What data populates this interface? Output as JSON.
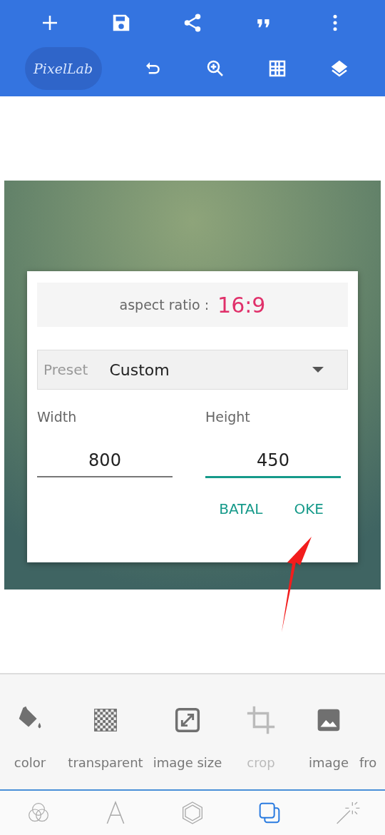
{
  "toolbar": {
    "logo": "PixelLab"
  },
  "dialog": {
    "aspect_label": "aspect ratio :",
    "aspect_value": "16:9",
    "preset": {
      "label": "Preset",
      "value": "Custom"
    },
    "fields": [
      {
        "label": "Width",
        "value": "800",
        "focused": false
      },
      {
        "label": "Height",
        "value": "450",
        "focused": true
      }
    ],
    "buttons": [
      "BATAL",
      "OKE"
    ]
  },
  "tools": [
    {
      "kind": "bucket",
      "label": "color",
      "disabled": false
    },
    {
      "kind": "checker",
      "label": "transparent",
      "disabled": false
    },
    {
      "kind": "resize",
      "label": "image size",
      "disabled": false
    },
    {
      "kind": "crop",
      "label": "crop",
      "disabled": true
    },
    {
      "kind": "image",
      "label": "image",
      "disabled": false
    },
    {
      "kind": "none",
      "label": "fro",
      "disabled": false
    }
  ],
  "bottom_nav": [
    {
      "kind": "circles",
      "selected": false
    },
    {
      "kind": "letter",
      "selected": false
    },
    {
      "kind": "hexagon",
      "selected": false
    },
    {
      "kind": "squares",
      "selected": true
    },
    {
      "kind": "wand",
      "selected": false
    }
  ]
}
